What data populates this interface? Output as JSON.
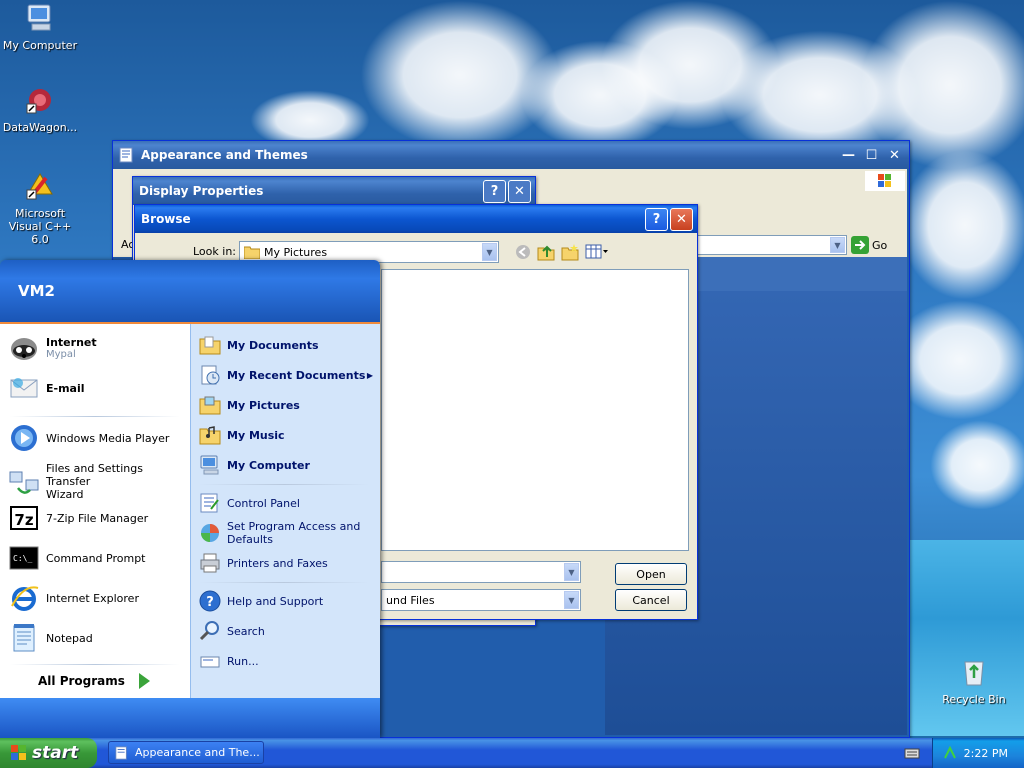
{
  "desktop": {
    "icons": [
      {
        "label": "My Computer"
      },
      {
        "label": "DataWagon..."
      },
      {
        "label": "Microsoft Visual C++ 6.0"
      },
      {
        "label": "Recycle Bin"
      }
    ]
  },
  "windows": {
    "appearance": {
      "title": "Appearance and Themes",
      "address_prefix": "Ac",
      "go_label": "Go"
    },
    "display_properties": {
      "title": "Display Properties"
    },
    "browse": {
      "title": "Browse",
      "look_in_label": "Look in:",
      "look_in_value": "My Pictures",
      "open_button": "Open",
      "cancel_button": "Cancel",
      "file_type_value": "und Files",
      "help_glyph": "?",
      "close_glyph": "✕"
    }
  },
  "start_menu": {
    "user": "VM2",
    "left_pinned": [
      {
        "label": "Internet",
        "sub": "Mypal",
        "icon": "raccoon-browser-icon"
      },
      {
        "label": "E-mail",
        "icon": "email-icon"
      }
    ],
    "left_recent": [
      {
        "label": "Windows Media Player",
        "icon": "media-player-icon"
      },
      {
        "label": "Files and Settings Transfer",
        "label2": "Wizard",
        "icon": "transfer-wizard-icon"
      },
      {
        "label": "7-Zip File Manager",
        "icon": "seven-zip-icon"
      },
      {
        "label": "Command Prompt",
        "icon": "command-prompt-icon"
      },
      {
        "label": "Internet Explorer",
        "icon": "internet-explorer-icon"
      },
      {
        "label": "Notepad",
        "icon": "notepad-icon"
      }
    ],
    "all_programs": "All Programs",
    "right_items": [
      {
        "label": "My Documents",
        "bold": true,
        "icon": "documents-folder-icon"
      },
      {
        "label": "My Recent Documents",
        "bold": true,
        "icon": "recent-documents-icon",
        "arrow": true
      },
      {
        "label": "My Pictures",
        "bold": true,
        "icon": "pictures-folder-icon"
      },
      {
        "label": "My Music",
        "bold": true,
        "icon": "music-folder-icon"
      },
      {
        "label": "My Computer",
        "bold": true,
        "icon": "computer-icon"
      },
      {
        "label": "Control Panel",
        "icon": "control-panel-icon"
      },
      {
        "label": "Set Program Access and",
        "label2": "Defaults",
        "icon": "program-access-icon"
      },
      {
        "label": "Printers and Faxes",
        "icon": "printer-icon"
      },
      {
        "label": "Help and Support",
        "icon": "help-icon"
      },
      {
        "label": "Search",
        "icon": "search-icon"
      },
      {
        "label": "Run...",
        "icon": "run-icon"
      }
    ]
  },
  "taskbar": {
    "start_label": "start",
    "task": "Appearance and The...",
    "clock": "2:22 PM"
  },
  "colors": {
    "xp_blue": "#0a5fd8",
    "start_green": "#389838",
    "menu_right_bg": "#d3e5fa"
  }
}
